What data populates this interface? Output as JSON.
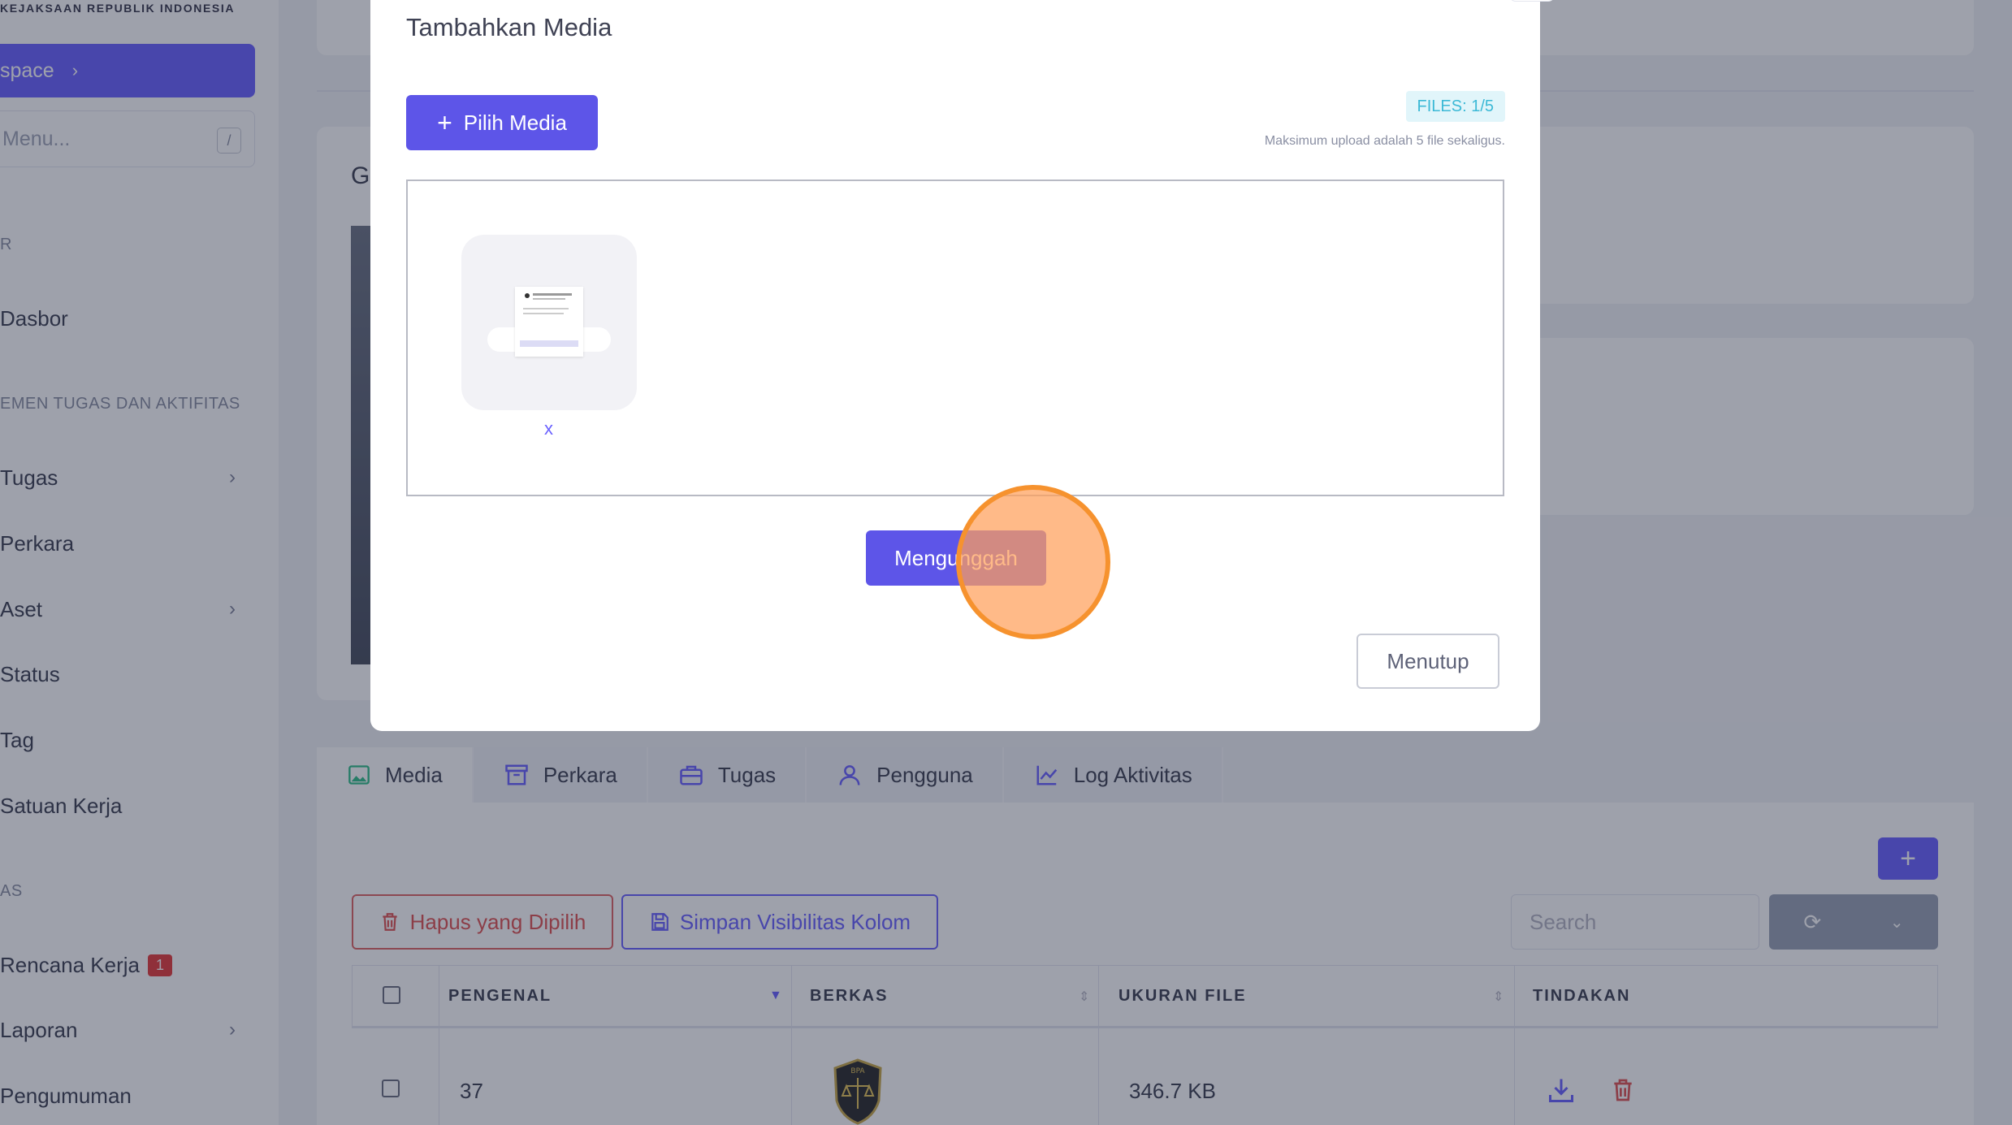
{
  "sidebar": {
    "brand": "KEJAKSAAN REPUBLIK INDONESIA",
    "workspace_label": "space",
    "search_placeholder": "Menu...",
    "search_shortcut": "/",
    "section_main": "R",
    "section_tasks": "EMEN TUGAS DAN AKTIFITAS",
    "section_other": "AS",
    "items": [
      {
        "label": "Dasbor"
      },
      {
        "label": "Tugas"
      },
      {
        "label": "Perkara"
      },
      {
        "label": "Aset"
      },
      {
        "label": "Status"
      },
      {
        "label": "Tag"
      },
      {
        "label": "Satuan Kerja"
      },
      {
        "label": "Rencana Kerja",
        "badge": "1"
      },
      {
        "label": "Laporan"
      },
      {
        "label": "Pengumuman"
      }
    ]
  },
  "main": {
    "card_heading_partial": "G",
    "tabs": [
      {
        "label": "Media"
      },
      {
        "label": "Perkara"
      },
      {
        "label": "Tugas"
      },
      {
        "label": "Pengguna"
      },
      {
        "label": "Log Aktivitas"
      }
    ],
    "toolbar": {
      "add_label": "+",
      "delete_selected_label": "Hapus yang Dipilih",
      "save_visibility_label": "Simpan Visibilitas Kolom",
      "search_placeholder": "Search"
    },
    "table": {
      "columns": [
        "PENGENAL",
        "BERKAS",
        "UKURAN FILE",
        "TINDAKAN"
      ],
      "rows": [
        {
          "id": "37",
          "file_badge": "BPA",
          "size": "346.7 KB"
        }
      ]
    }
  },
  "modal": {
    "title": "Tambahkan Media",
    "pick_label": "Pilih Media",
    "files_count": "FILES: 1/5",
    "max_note": "Maksimum upload adalah 5 file sekaligus.",
    "remove_label": "x",
    "upload_label": "Mengunggah",
    "close_label": "Menutup"
  },
  "colors": {
    "primary": "#5d55e8",
    "danger": "#e05555",
    "info": "#3cb9d6",
    "click_marker": "#f6922e"
  }
}
